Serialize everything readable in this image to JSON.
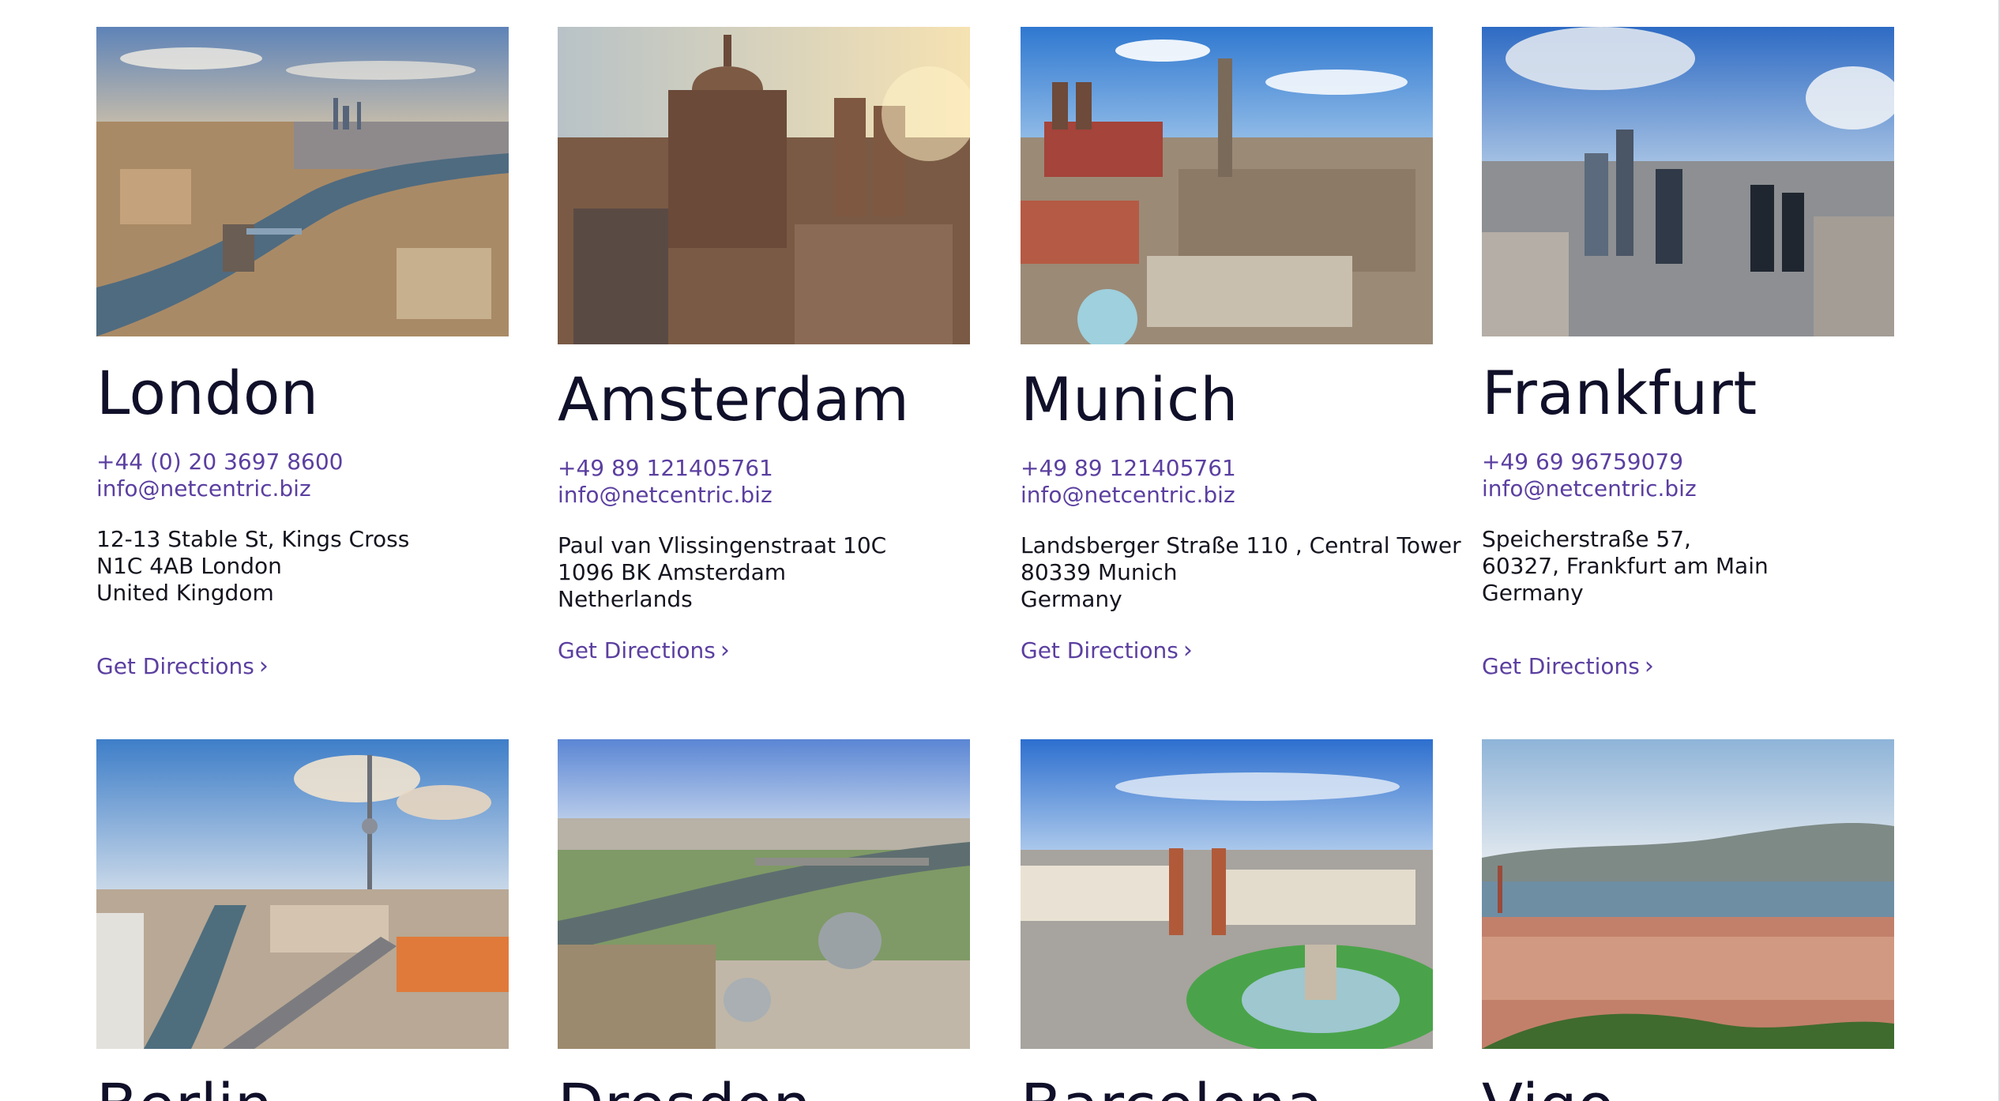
{
  "offices_row1": [
    {
      "city": "London",
      "phone": "+44 (0) 20 3697 8600",
      "email": "info@netcentric.biz",
      "address": [
        "12-13 Stable St, Kings Cross",
        "N1C 4AB London",
        "United Kingdom"
      ],
      "directions_label": "Get Directions",
      "image_icon": "london-skyline-image"
    },
    {
      "city": "Amsterdam",
      "phone": "+49 89 121405761",
      "email": "info@netcentric.biz",
      "address": [
        "Paul van Vlissingenstraat 10C",
        "1096 BK Amsterdam",
        "Netherlands"
      ],
      "directions_label": "Get Directions",
      "image_icon": "amsterdam-cityscape-image"
    },
    {
      "city": "Munich",
      "phone": "+49 89 121405761",
      "email": "info@netcentric.biz",
      "address": [
        "Landsberger Straße 110 , Central Tower",
        "80339 Munich",
        "Germany"
      ],
      "directions_label": "Get Directions",
      "image_icon": "munich-marienplatz-image"
    },
    {
      "city": "Frankfurt",
      "phone": "+49 69 96759079",
      "email": "info@netcentric.biz",
      "address": [
        "Speicherstraße 57,",
        "60327, Frankfurt am Main",
        "Germany"
      ],
      "directions_label": "Get Directions",
      "image_icon": "frankfurt-skyline-image"
    }
  ],
  "offices_row2": [
    {
      "city": "Berlin",
      "image_icon": "berlin-tv-tower-image"
    },
    {
      "city": "Dresden",
      "image_icon": "dresden-elbe-image"
    },
    {
      "city": "Barcelona",
      "image_icon": "barcelona-plaza-espanya-image"
    },
    {
      "city": "Vigo",
      "image_icon": "vigo-harbour-image"
    }
  ],
  "colors": {
    "link": "#5b3fa0",
    "heading": "#10102a",
    "body_text": "#151520",
    "background": "#ffffff"
  }
}
